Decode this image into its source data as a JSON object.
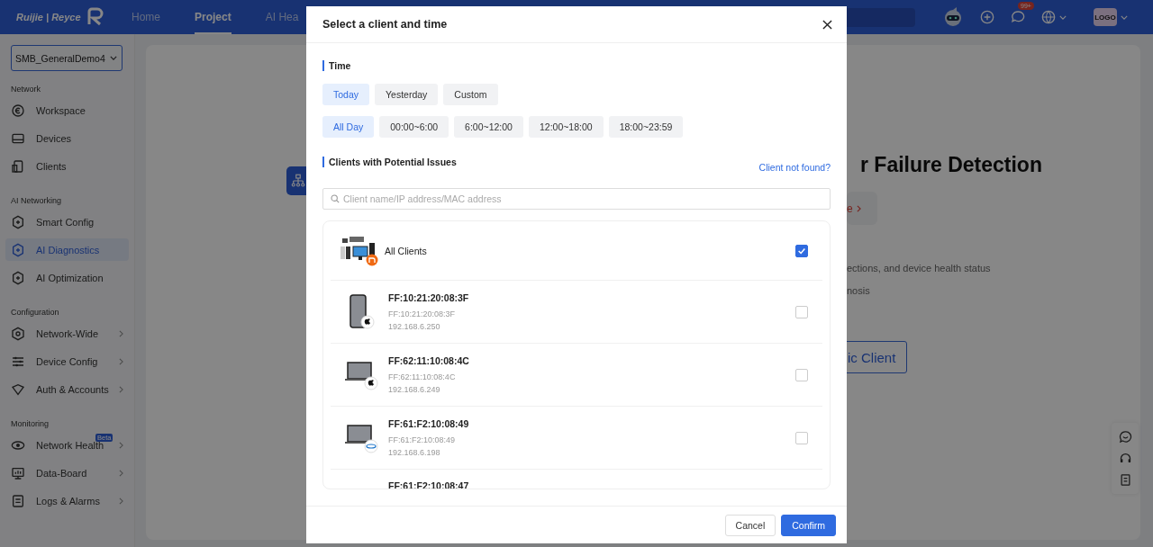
{
  "topbar": {
    "logo_text": "Ruijie | Reyce",
    "nav": [
      {
        "label": "Home",
        "selected": false
      },
      {
        "label": "Project",
        "selected": true
      },
      {
        "label": "AI Hea",
        "selected": false
      }
    ],
    "notification_badge": "99+",
    "avatar_text": "LOGO"
  },
  "sidebar": {
    "project": "SMB_GeneralDemo4",
    "sections": [
      {
        "title": "Network",
        "items": [
          {
            "label": "Workspace",
            "selected": false,
            "submenu": false
          },
          {
            "label": "Devices",
            "selected": false,
            "submenu": false
          },
          {
            "label": "Clients",
            "selected": false,
            "submenu": false
          }
        ]
      },
      {
        "title": "AI Networking",
        "items": [
          {
            "label": "Smart Config",
            "selected": false,
            "submenu": false
          },
          {
            "label": "AI Diagnostics",
            "selected": true,
            "submenu": false
          },
          {
            "label": "AI Optimization",
            "selected": false,
            "submenu": false
          }
        ]
      },
      {
        "title": "Configuration",
        "items": [
          {
            "label": "Network-Wide",
            "selected": false,
            "submenu": true
          },
          {
            "label": "Device Config",
            "selected": false,
            "submenu": true
          },
          {
            "label": "Auth & Accounts",
            "selected": false,
            "submenu": true
          }
        ]
      },
      {
        "title": "Monitoring",
        "items": [
          {
            "label": "Network Health",
            "selected": false,
            "submenu": true,
            "badge": "Beta"
          },
          {
            "label": "Data-Board",
            "selected": false,
            "submenu": true
          },
          {
            "label": "Logs & Alarms",
            "selected": false,
            "submenu": true
          }
        ]
      }
    ]
  },
  "main": {
    "title": "r Failure Detection",
    "link": "e",
    "lines": [
      "ections, and device health status",
      "nosis"
    ],
    "button": "ic Client"
  },
  "modal": {
    "title": "Select a client and time",
    "time_title": "Time",
    "days": [
      {
        "label": "Today",
        "selected": true
      },
      {
        "label": "Yesterday",
        "selected": false
      },
      {
        "label": "Custom",
        "selected": false
      }
    ],
    "ranges": [
      {
        "label": "All Day",
        "selected": true
      },
      {
        "label": "00:00~6:00",
        "selected": false
      },
      {
        "label": "6:00~12:00",
        "selected": false
      },
      {
        "label": "12:00~18:00",
        "selected": false
      },
      {
        "label": "18:00~23:59",
        "selected": false
      }
    ],
    "clients_title": "Clients with Potential Issues",
    "not_found_link": "Client not found?",
    "search": {
      "placeholder": "Client name/IP address/MAC address"
    },
    "all_clients": {
      "label": "All Clients",
      "checked": true
    },
    "clients": [
      {
        "name": "FF:10:21:20:08:3F",
        "mac": "FF:10:21:20:08:3F",
        "ip": "192.168.6.250",
        "checked": false
      },
      {
        "name": "FF:62:11:10:08:4C",
        "mac": "FF:62:11:10:08:4C",
        "ip": "192.168.6.249",
        "checked": false
      },
      {
        "name": "FF:61:F2:10:08:49",
        "mac": "FF:61:F2:10:08:49",
        "ip": "192.168.6.198",
        "checked": false
      },
      {
        "name": "FF:61:F2:10:08:47"
      }
    ],
    "buttons": {
      "cancel": "Cancel",
      "confirm": "Confirm"
    }
  }
}
